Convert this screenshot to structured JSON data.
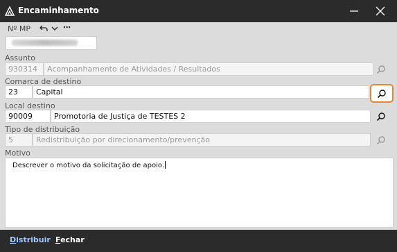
{
  "window": {
    "title": "Encaminhamento",
    "icon": "app-triangle-icon"
  },
  "header": {
    "mp_label": "Nº MP",
    "more_label": "⋯"
  },
  "fields": {
    "assunto": {
      "label": "Assunto",
      "code": "930314",
      "description": "Acompanhamento de Atividades / Resultados",
      "enabled": false
    },
    "comarca": {
      "label": "Comarca de destino",
      "code": "23",
      "description": "Capital",
      "enabled": true
    },
    "local": {
      "label": "Local destino",
      "code": "90009",
      "description": "Promotoria de Justiça de TESTES 2",
      "enabled": true
    },
    "tipo": {
      "label": "Tipo de distribuição",
      "code": "5",
      "description": "Redistribuição por direcionamento/prevenção",
      "enabled": false
    },
    "motivo": {
      "label": "Motivo",
      "value": "Descrever o motivo da solicitação de apoio."
    }
  },
  "footer": {
    "primary": {
      "mnemonic": "D",
      "rest": "istribuir"
    },
    "secondary": {
      "mnemonic": "F",
      "rest": "echar"
    }
  },
  "colors": {
    "chrome": "#2b2b2b",
    "accent_highlight": "#e0863a",
    "primary_link": "#9ec7ff"
  }
}
